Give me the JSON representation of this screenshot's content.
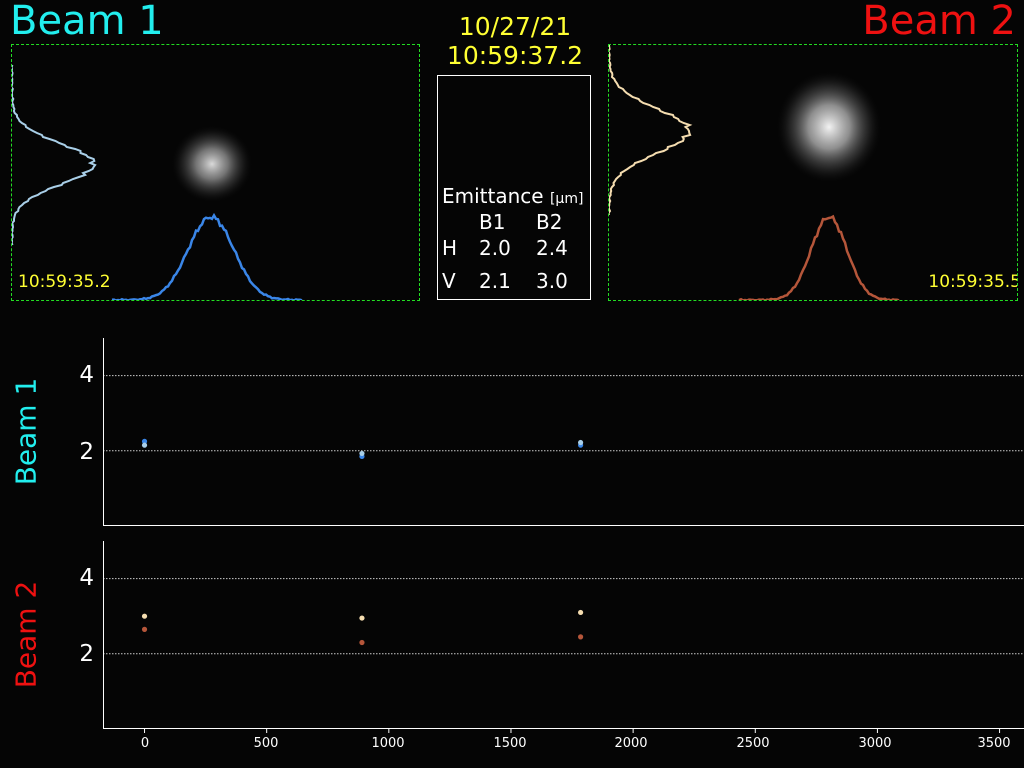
{
  "header": {
    "beam1_title": "Beam 1",
    "beam2_title": "Beam 2",
    "date": "10/27/21",
    "time": "10:59:37.2"
  },
  "colors": {
    "beam1": "#22eeee",
    "beam2": "#ee1111",
    "timestamp": "#ffff33",
    "frame": "#22dd22",
    "b1_h_series": "#3a86e8",
    "b1_v_series": "#a9cfe8",
    "b2_h_series": "#b5563a",
    "b2_v_series": "#f5ddb0"
  },
  "camera": {
    "beam1_timestamp": "10:59:35.2",
    "beam2_timestamp": "10:59:35.5"
  },
  "emittance": {
    "title": "Emittance",
    "unit": "[μm]",
    "col_b1": "B1",
    "col_b2": "B2",
    "row_h": "H",
    "row_v": "V",
    "h_b1": "2.0",
    "h_b2": "2.4",
    "v_b1": "2.1",
    "v_b2": "3.0"
  },
  "chart_data": [
    {
      "type": "scatter",
      "ylabel": "Beam 1",
      "ylim": [
        0,
        5
      ],
      "xlim": [
        -170,
        3600
      ],
      "yticks": [
        "2",
        "4"
      ],
      "grid": "horizontal dotted at 2 and 4",
      "series": [
        {
          "color": "#3a86e8",
          "x": [
            0,
            890,
            1785
          ],
          "y": [
            2.25,
            1.85,
            2.15
          ]
        },
        {
          "color": "#a9cfe8",
          "x": [
            0,
            890,
            1785
          ],
          "y": [
            2.15,
            1.93,
            2.22
          ]
        }
      ]
    },
    {
      "type": "scatter",
      "ylabel": "Beam 2",
      "ylim": [
        0,
        5
      ],
      "xlim": [
        -170,
        3600
      ],
      "yticks": [
        "2",
        "4"
      ],
      "xticks": [
        "0",
        "500",
        "1000",
        "1500",
        "2000",
        "2500",
        "3000",
        "3500"
      ],
      "grid": "horizontal dotted at 2 and 4",
      "series": [
        {
          "color": "#b5563a",
          "x": [
            0,
            890,
            1785
          ],
          "y": [
            2.65,
            2.3,
            2.45
          ]
        },
        {
          "color": "#f5ddb0",
          "x": [
            0,
            890,
            1785
          ],
          "y": [
            3.0,
            2.95,
            3.1
          ]
        }
      ]
    }
  ]
}
